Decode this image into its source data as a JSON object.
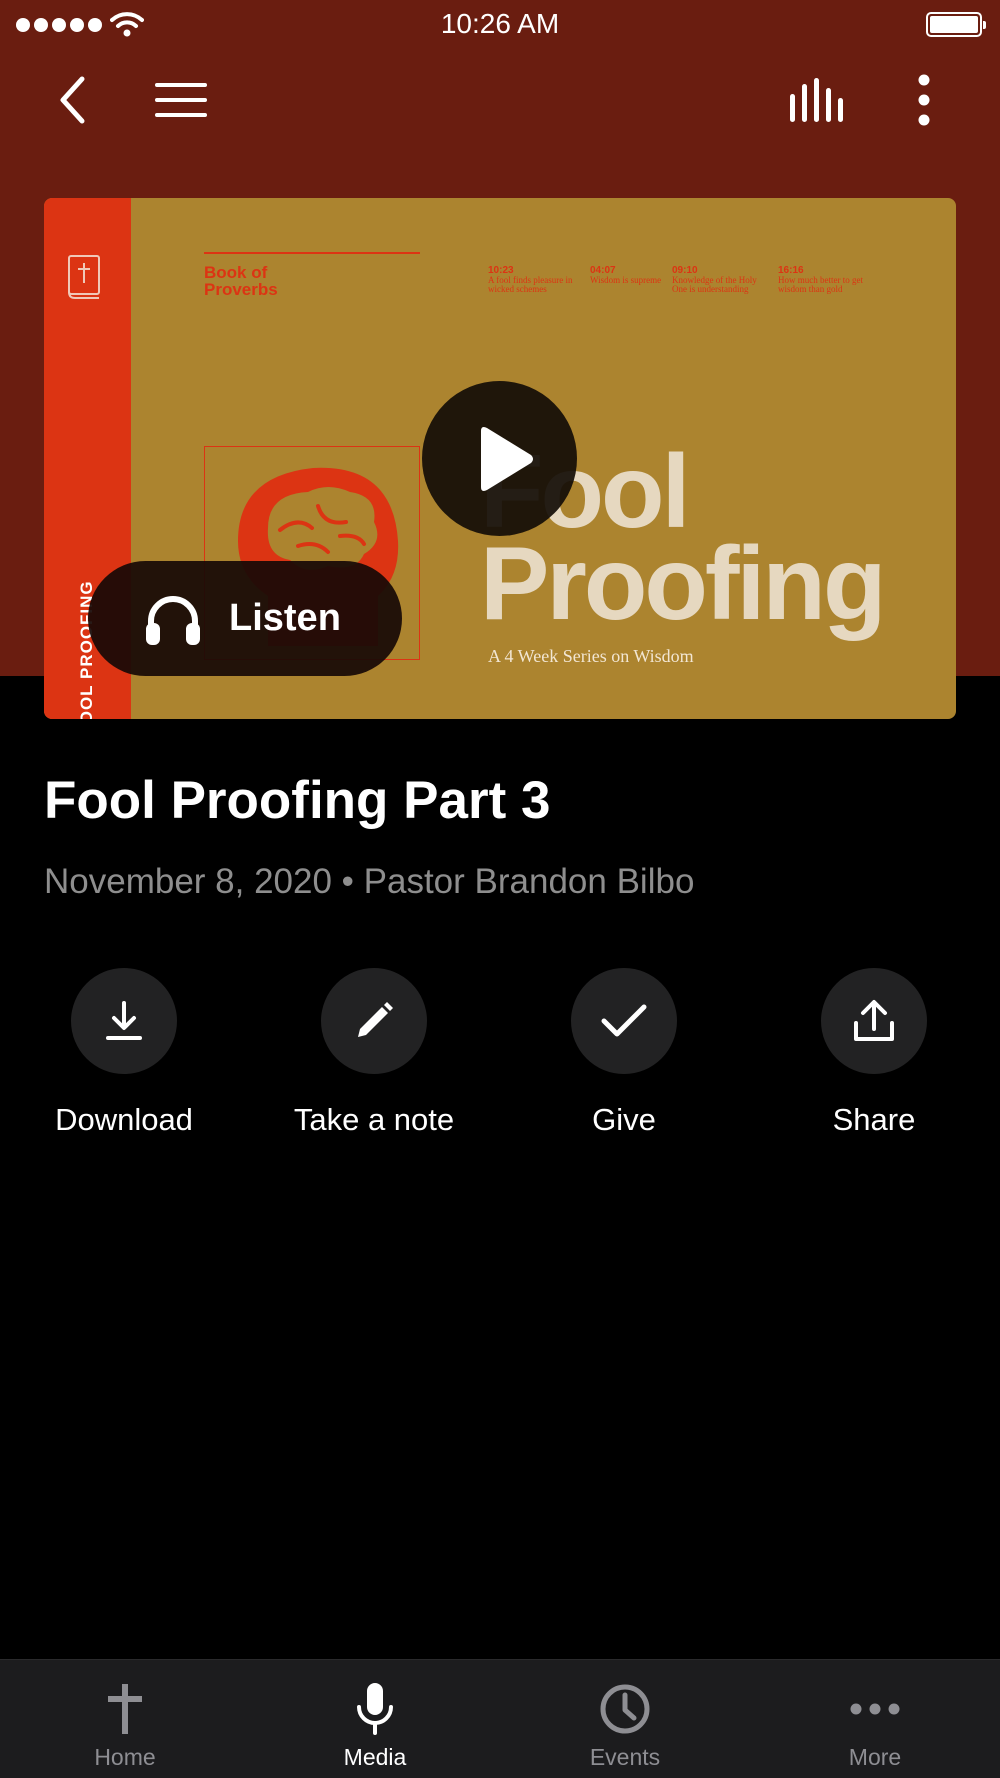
{
  "status_bar": {
    "time": "10:26 AM"
  },
  "nav": {
    "back_icon": "chevron-left-icon",
    "menu_icon": "hamburger-menu-icon",
    "audio_icon": "audio-bars-icon",
    "more_icon": "vertical-ellipsis-icon"
  },
  "artwork": {
    "spine_text": "FOOL PROOFING",
    "book_label": "Book of Proverbs",
    "columns": [
      {
        "ref": "10:23",
        "text": "A fool finds pleasure in wicked schemes"
      },
      {
        "ref": "04:07",
        "text": "Wisdom is supreme"
      },
      {
        "ref": "09:10",
        "text": "Knowledge of the Holy One is understanding"
      },
      {
        "ref": "16:16",
        "text": "How much better to get wisdom than gold"
      }
    ],
    "title_line1": "Fool",
    "title_line2": "Proofing",
    "subtitle": "A 4 Week Series on Wisdom"
  },
  "player": {
    "play_icon": "play-icon",
    "listen_label": "Listen",
    "listen_icon": "headphones-icon"
  },
  "sermon": {
    "title": "Fool Proofing Part 3",
    "meta": "November 8, 2020 • Pastor Brandon Bilbo"
  },
  "actions": [
    {
      "label": "Download",
      "icon": "download-icon"
    },
    {
      "label": "Take a note",
      "icon": "pencil-icon"
    },
    {
      "label": "Give",
      "icon": "checkmark-icon"
    },
    {
      "label": "Share",
      "icon": "share-icon"
    }
  ],
  "tabs": [
    {
      "label": "Home",
      "icon": "cross-icon",
      "active": false
    },
    {
      "label": "Media",
      "icon": "microphone-icon",
      "active": true
    },
    {
      "label": "Events",
      "icon": "clock-icon",
      "active": false
    },
    {
      "label": "More",
      "icon": "horizontal-ellipsis-icon",
      "active": false
    }
  ],
  "colors": {
    "header_bg": "#6a1d10",
    "artwork_bg": "#ac842f",
    "artwork_accent": "#dc3413",
    "artwork_title": "#e6d8c0",
    "meta_text": "#8e8e8e",
    "action_circle": "#222223",
    "tab_bar": "#1c1c1e"
  }
}
